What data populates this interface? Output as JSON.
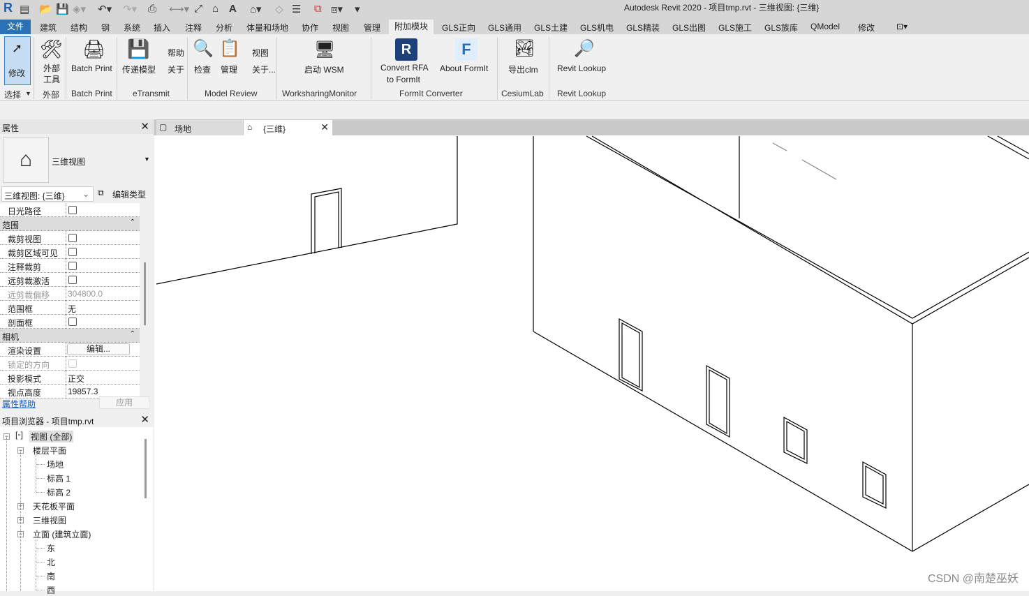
{
  "window_title": "Autodesk Revit 2020 - 项目tmp.rvt - 三维视图: {三维}",
  "quick_access": [
    "revit-logo-icon",
    "recent-files-icon",
    "open-icon",
    "save-icon",
    "sync-icon",
    "undo-icon",
    "redo-icon",
    "print-icon",
    "measure-icon",
    "dimension-icon",
    "tag-icon",
    "text-icon",
    "3d-view-icon",
    "section-icon",
    "thin-lines-icon",
    "close-hidden-icon",
    "switch-windows-icon",
    "customize-icon"
  ],
  "tabs": [
    "文件",
    "建筑",
    "结构",
    "钢",
    "系统",
    "插入",
    "注释",
    "分析",
    "体量和场地",
    "协作",
    "视图",
    "管理",
    "附加模块",
    "GLS正向",
    "GLS通用",
    "GLS土建",
    "GLS机电",
    "GLS精装",
    "GLS出图",
    "GLS施工",
    "GLS族库",
    "QModel",
    "修改"
  ],
  "active_tab": "附加模块",
  "ribbon": {
    "modify": "修改",
    "select": "选择",
    "external_tools": [
      "外部",
      "工具"
    ],
    "external_panel": "外部",
    "batch_print": "Batch Print",
    "batch_print_panel": "Batch Print",
    "transmit": "传递模型",
    "help": "帮助",
    "about": "关于",
    "etransmit_panel": "eTransmit",
    "check": "检查",
    "manage": "管理",
    "view": "视图",
    "about2": "关于...",
    "model_review_panel": "Model Review",
    "wsm": "启动 WSM",
    "wsm_panel": "WorksharingMonitor",
    "convert_rfa": [
      "Convert RFA",
      "to FormIt"
    ],
    "about_formit": "About FormIt",
    "formit_panel": "FormIt Converter",
    "export_clm": "导出clm",
    "cesium_panel": "CesiumLab",
    "revit_lookup": "Revit Lookup",
    "lookup_panel": "Revit Lookup"
  },
  "properties": {
    "title": "属性",
    "type_name": "三维视图",
    "instance_select": "三维视图: {三维}",
    "edit_type": "编辑类型",
    "rows": [
      {
        "k": "日光路径",
        "type": "check",
        "checked": false
      },
      {
        "k": "范围",
        "type": "group"
      },
      {
        "k": "裁剪视图",
        "type": "check",
        "checked": false
      },
      {
        "k": "裁剪区域可见",
        "type": "check",
        "checked": false
      },
      {
        "k": "注释裁剪",
        "type": "check",
        "checked": false
      },
      {
        "k": "远剪裁激活",
        "type": "check",
        "checked": false
      },
      {
        "k": "远剪裁偏移",
        "v": "304800.0",
        "disabled": true
      },
      {
        "k": "范围框",
        "v": "无"
      },
      {
        "k": "剖面框",
        "type": "check",
        "checked": false
      },
      {
        "k": "相机",
        "type": "group"
      },
      {
        "k": "渲染设置",
        "type": "button",
        "v": "编辑..."
      },
      {
        "k": "锁定的方向",
        "type": "check",
        "disabled": true
      },
      {
        "k": "投影模式",
        "v": "正交"
      },
      {
        "k": "视点高度",
        "v": "19857.3"
      }
    ],
    "help_link": "属性帮助",
    "apply": "应用"
  },
  "browser": {
    "title": "项目浏览器 - 项目tmp.rvt",
    "items": [
      {
        "label": "视图 (全部)",
        "level": 0,
        "toggle": "-"
      },
      {
        "label": "楼层平面",
        "level": 1,
        "toggle": "-"
      },
      {
        "label": "场地",
        "level": 2
      },
      {
        "label": "标高 1",
        "level": 2
      },
      {
        "label": "标高 2",
        "level": 2
      },
      {
        "label": "天花板平面",
        "level": 1,
        "toggle": "+"
      },
      {
        "label": "三维视图",
        "level": 1,
        "toggle": "+"
      },
      {
        "label": "立面 (建筑立面)",
        "level": 1,
        "toggle": "-"
      },
      {
        "label": "东",
        "level": 2
      },
      {
        "label": "北",
        "level": 2
      },
      {
        "label": "南",
        "level": 2
      },
      {
        "label": "西",
        "level": 2
      }
    ]
  },
  "view_tabs": [
    {
      "label": "场地",
      "active": false
    },
    {
      "label": "{三维}",
      "active": true
    }
  ],
  "watermark": "CSDN @南楚巫妖",
  "colors": {
    "accent": "#2a72b5",
    "selected": "#c5dcf3"
  }
}
